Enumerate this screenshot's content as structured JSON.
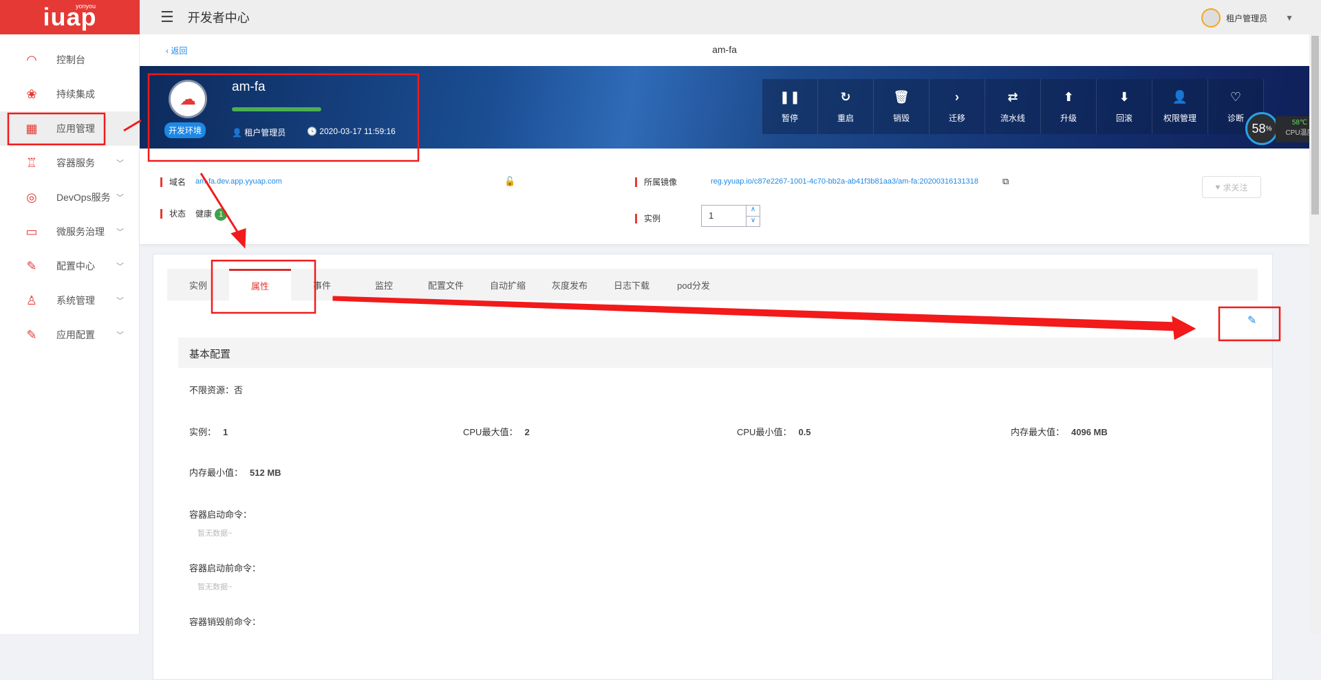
{
  "header": {
    "logo": "iuap",
    "logo_small": "yonyou",
    "title": "开发者中心",
    "user": "租户管理员"
  },
  "sidebar": {
    "items": [
      {
        "label": "控制台",
        "icon": "dashboard-icon",
        "glyph": "◠"
      },
      {
        "label": "持续集成",
        "icon": "clover-icon",
        "glyph": "❀"
      },
      {
        "label": "应用管理",
        "icon": "grid-icon",
        "glyph": "▦"
      },
      {
        "label": "容器服务",
        "icon": "hierarchy-icon",
        "glyph": "♖"
      },
      {
        "label": "DevOps服务",
        "icon": "lifebuoy-icon",
        "glyph": "◎"
      },
      {
        "label": "微服务治理",
        "icon": "laptop-icon",
        "glyph": "▭"
      },
      {
        "label": "配置中心",
        "icon": "wrench-icon",
        "glyph": "✎"
      },
      {
        "label": "系统管理",
        "icon": "user-gear-icon",
        "glyph": "♙"
      },
      {
        "label": "应用配置",
        "icon": "wrench-icon",
        "glyph": "✎"
      }
    ]
  },
  "page": {
    "back": "返回",
    "title": "am-fa"
  },
  "banner": {
    "name": "am-fa",
    "env": "开发环境",
    "owner": "租户管理员",
    "time": "2020-03-17 11:59:16",
    "progress": 100,
    "actions": [
      {
        "label": "暂停",
        "glyph": "❚❚",
        "icon": "pause-icon"
      },
      {
        "label": "重启",
        "glyph": "↻",
        "icon": "restart-icon"
      },
      {
        "label": "销毁",
        "glyph": "🗑",
        "icon": "trash-icon"
      },
      {
        "label": "迁移",
        "glyph": "›",
        "icon": "migrate-icon"
      },
      {
        "label": "流水线",
        "glyph": "⇄",
        "icon": "pipeline-icon"
      },
      {
        "label": "升级",
        "glyph": "⬆",
        "icon": "upgrade-icon"
      },
      {
        "label": "回滚",
        "glyph": "⬇",
        "icon": "rollback-icon"
      },
      {
        "label": "权限管理",
        "glyph": "👤",
        "icon": "permission-icon"
      },
      {
        "label": "诊断",
        "glyph": "♡",
        "icon": "diagnose-icon"
      }
    ]
  },
  "cpu": {
    "usage": "58",
    "unit": "%",
    "temp": "58℃",
    "label": "CPU温度"
  },
  "info": {
    "domain_label": "域名",
    "domain": "am-fa.dev.app.yyuap.com",
    "image_label": "所属镜像",
    "image": "reg.yyuap.io/c87e2267-1001-4c70-bb2a-ab41f3b81aa3/am-fa:20200316131318",
    "status_label": "状态",
    "status": "健康",
    "status_count": "1",
    "instance_label": "实例",
    "instance_value": "1",
    "follow": "求关注"
  },
  "tabs": [
    "实例",
    "属性",
    "事件",
    "监控",
    "配置文件",
    "自动扩缩",
    "灰度发布",
    "日志下载",
    "pod分发"
  ],
  "section": {
    "title": "基本配置",
    "unlimited_label": "不限资源：",
    "unlimited": "否",
    "fields": [
      {
        "label": "实例：",
        "value": "1"
      },
      {
        "label": "CPU最大值：",
        "value": "2"
      },
      {
        "label": "CPU最小值：",
        "value": "0.5"
      },
      {
        "label": "内存最大值：",
        "value": "4096 MB"
      }
    ],
    "mem_min_label": "内存最小值：",
    "mem_min": "512 MB",
    "commands": [
      {
        "label": "容器启动命令：",
        "value": "暂无数据~"
      },
      {
        "label": "容器启动前命令：",
        "value": "暂无数据~"
      },
      {
        "label": "容器销毁前命令：",
        "value": ""
      }
    ]
  }
}
